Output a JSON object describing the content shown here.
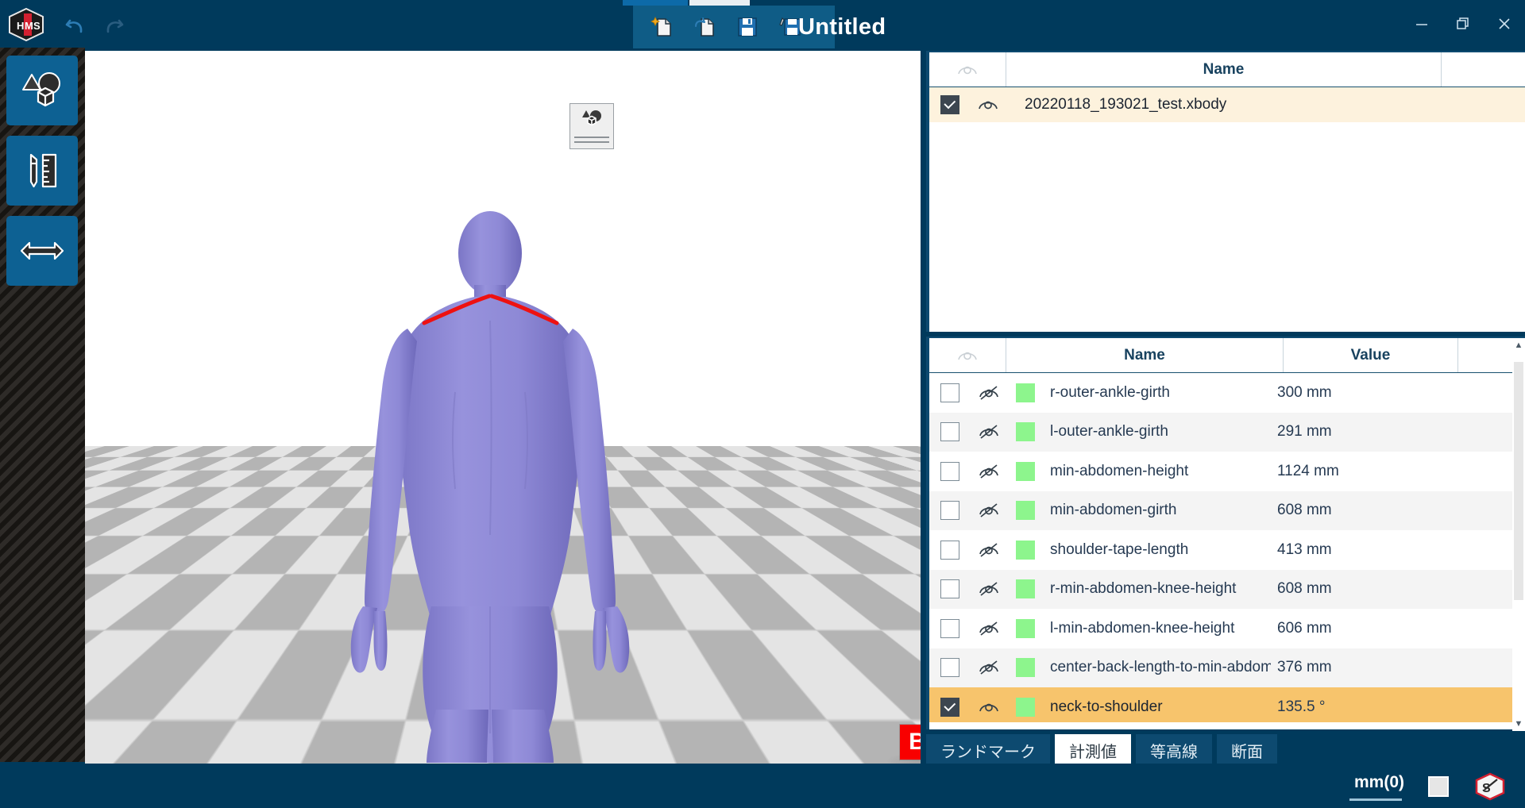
{
  "window": {
    "title": "Untitled",
    "controls": [
      {
        "name": "minimize",
        "glyph": "−"
      },
      {
        "name": "restore",
        "glyph": "❐"
      },
      {
        "name": "close",
        "glyph": "✕"
      }
    ]
  },
  "titlebar": {
    "logo_name": "hms-app-logo",
    "undo_label": "undo-icon",
    "redo_label": "redo-icon",
    "tools": [
      {
        "name": "new-file-icon"
      },
      {
        "name": "open-file-icon"
      },
      {
        "name": "save-icon"
      },
      {
        "name": "save-as-icon"
      }
    ]
  },
  "left_toolbar": {
    "items": [
      {
        "name": "model-view-tool",
        "icon": "shapes-cube-icon"
      },
      {
        "name": "measure-tool",
        "icon": "pencil-ruler-icon"
      },
      {
        "name": "distance-tool",
        "icon": "double-arrow-icon"
      }
    ]
  },
  "viewport": {
    "orientation_badge": "B",
    "floating_tool_name": "view-rotate-tool",
    "model_color": "#8b86d4",
    "highlight_color": "#ee1111"
  },
  "object_panel": {
    "header": {
      "eye_icon": "eye-icon",
      "name": "Name"
    },
    "rows": [
      {
        "checked": true,
        "eye": "visible",
        "name": "20220118_193021_test.xbody"
      }
    ]
  },
  "measure_panel": {
    "header": {
      "eye_icon": "eye-icon",
      "name": "Name",
      "value": "Value"
    },
    "rows": [
      {
        "checked": false,
        "visible": false,
        "color": "#8df58d",
        "name": "r-outer-ankle-girth",
        "value": "300 mm"
      },
      {
        "checked": false,
        "visible": false,
        "color": "#8df58d",
        "name": "l-outer-ankle-girth",
        "value": "291 mm"
      },
      {
        "checked": false,
        "visible": false,
        "color": "#8df58d",
        "name": "min-abdomen-height",
        "value": "1124 mm"
      },
      {
        "checked": false,
        "visible": false,
        "color": "#8df58d",
        "name": "min-abdomen-girth",
        "value": "608 mm"
      },
      {
        "checked": false,
        "visible": false,
        "color": "#8df58d",
        "name": "shoulder-tape-length",
        "value": "413 mm"
      },
      {
        "checked": false,
        "visible": false,
        "color": "#8df58d",
        "name": "r-min-abdomen-knee-height",
        "value": "608 mm"
      },
      {
        "checked": false,
        "visible": false,
        "color": "#8df58d",
        "name": "l-min-abdomen-knee-height",
        "value": "606 mm"
      },
      {
        "checked": false,
        "visible": false,
        "color": "#8df58d",
        "name": "center-back-length-to-min-abdom",
        "value": "376 mm"
      },
      {
        "checked": true,
        "visible": true,
        "color": "#8df58d",
        "name": "neck-to-shoulder",
        "value": "135.5 °"
      }
    ]
  },
  "bottom_tabs": [
    {
      "label": "ランドマーク",
      "active": false
    },
    {
      "label": "計測値",
      "active": true
    },
    {
      "label": "等高線",
      "active": false
    },
    {
      "label": "断面",
      "active": false
    }
  ],
  "statusbar": {
    "unit": "mm(0)",
    "square_button": "color-swatch-button",
    "corner_logo": "app-mark-icon"
  }
}
